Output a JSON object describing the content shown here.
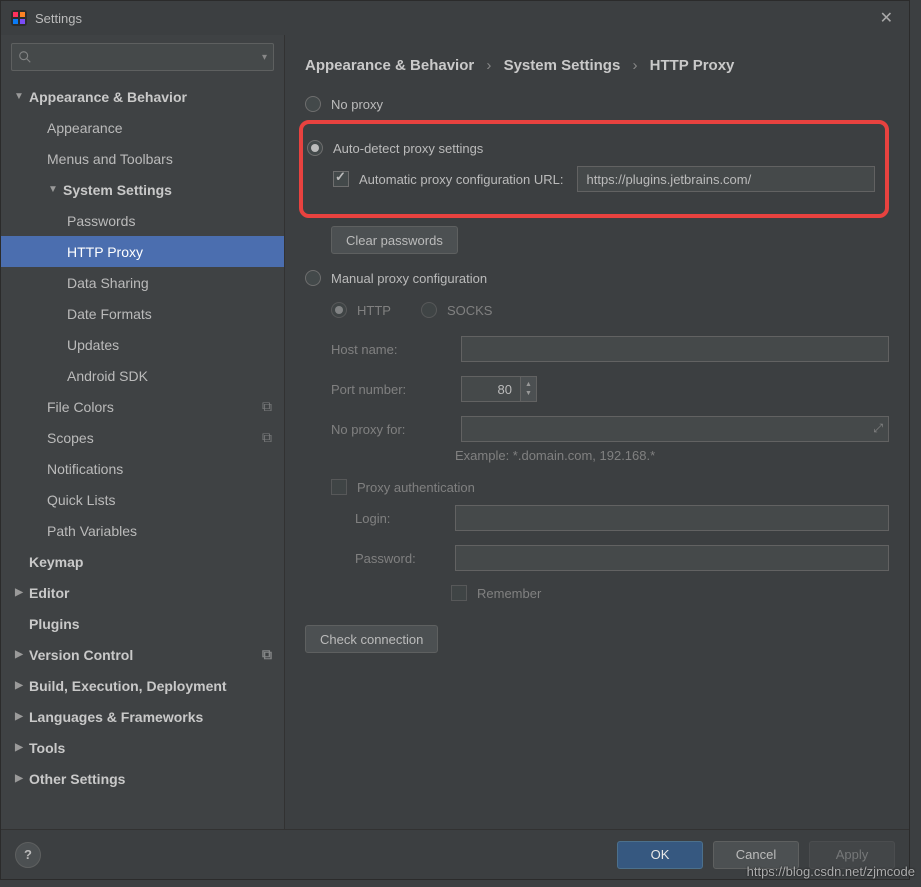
{
  "window": {
    "title": "Settings"
  },
  "search": {
    "placeholder": ""
  },
  "sidebar": {
    "items": [
      {
        "label": "Appearance & Behavior",
        "bold": true,
        "arrow": "down",
        "depth": 0
      },
      {
        "label": "Appearance",
        "depth": 1
      },
      {
        "label": "Menus and Toolbars",
        "depth": 1
      },
      {
        "label": "System Settings",
        "bold": true,
        "arrow": "down",
        "depth": 1
      },
      {
        "label": "Passwords",
        "depth": 2
      },
      {
        "label": "HTTP Proxy",
        "depth": 2,
        "selected": true
      },
      {
        "label": "Data Sharing",
        "depth": 2
      },
      {
        "label": "Date Formats",
        "depth": 2
      },
      {
        "label": "Updates",
        "depth": 2
      },
      {
        "label": "Android SDK",
        "depth": 2
      },
      {
        "label": "File Colors",
        "depth": 1,
        "trail": true
      },
      {
        "label": "Scopes",
        "depth": 1,
        "trail": true
      },
      {
        "label": "Notifications",
        "depth": 1
      },
      {
        "label": "Quick Lists",
        "depth": 1
      },
      {
        "label": "Path Variables",
        "depth": 1
      },
      {
        "label": "Keymap",
        "bold": true,
        "depth": 0
      },
      {
        "label": "Editor",
        "bold": true,
        "arrow": "right",
        "depth": 0
      },
      {
        "label": "Plugins",
        "bold": true,
        "depth": 0
      },
      {
        "label": "Version Control",
        "bold": true,
        "arrow": "right",
        "depth": 0,
        "trail": true
      },
      {
        "label": "Build, Execution, Deployment",
        "bold": true,
        "arrow": "right",
        "depth": 0
      },
      {
        "label": "Languages & Frameworks",
        "bold": true,
        "arrow": "right",
        "depth": 0
      },
      {
        "label": "Tools",
        "bold": true,
        "arrow": "right",
        "depth": 0
      },
      {
        "label": "Other Settings",
        "bold": true,
        "arrow": "right",
        "depth": 0
      }
    ]
  },
  "breadcrumb": {
    "a": "Appearance & Behavior",
    "b": "System Settings",
    "c": "HTTP Proxy",
    "sep": "›"
  },
  "proxy": {
    "no_proxy": "No proxy",
    "auto_detect": "Auto-detect proxy settings",
    "auto_url_label": "Automatic proxy configuration URL:",
    "auto_url_value": "https://plugins.jetbrains.com/",
    "clear_passwords": "Clear passwords",
    "manual": "Manual proxy configuration",
    "http": "HTTP",
    "socks": "SOCKS",
    "host_label": "Host name:",
    "host_value": "",
    "port_label": "Port number:",
    "port_value": "80",
    "noproxy_label": "No proxy for:",
    "noproxy_value": "",
    "example": "Example: *.domain.com, 192.168.*",
    "auth_label": "Proxy authentication",
    "login_label": "Login:",
    "login_value": "",
    "password_label": "Password:",
    "password_value": "",
    "remember": "Remember",
    "check_connection": "Check connection"
  },
  "footer": {
    "help": "?",
    "ok": "OK",
    "cancel": "Cancel",
    "apply": "Apply"
  },
  "watermark": "https://blog.csdn.net/zjmcode"
}
